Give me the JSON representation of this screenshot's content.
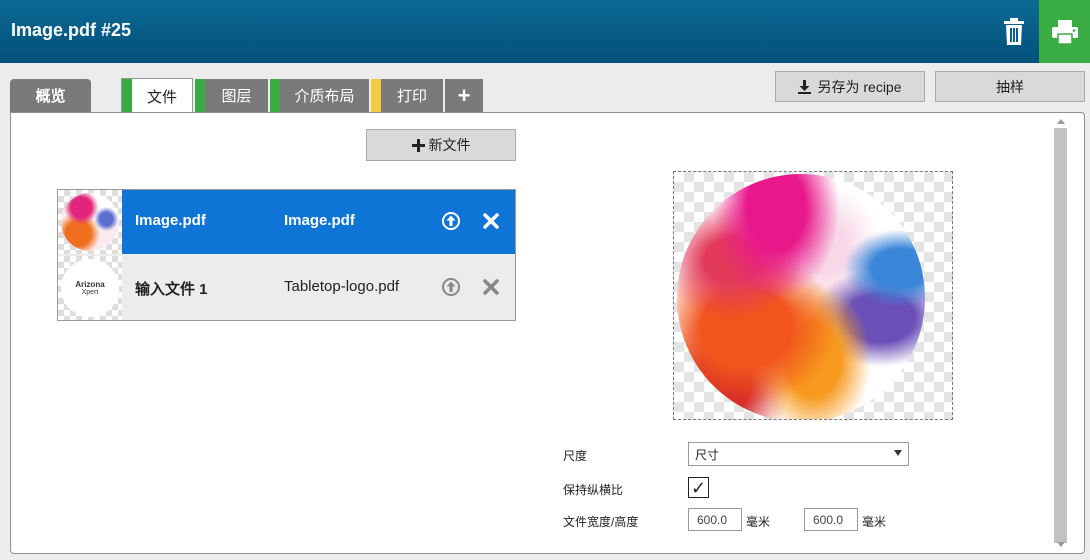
{
  "header": {
    "title": "Image.pdf #25",
    "icons": {
      "delete": "trash-icon",
      "print": "printer-icon"
    },
    "colors": {
      "bar": "#03507a",
      "print_button": "#3aac44"
    }
  },
  "tabs": [
    {
      "label": "概览",
      "marker_color": ""
    },
    {
      "label": "文件",
      "marker_color": "#3aac44"
    },
    {
      "label": "图层",
      "marker_color": "#3aac44"
    },
    {
      "label": "介质布局",
      "marker_color": "#3aac44"
    },
    {
      "label": "打印",
      "marker_color": "#f5c842"
    },
    {
      "label": "+",
      "marker_color": ""
    }
  ],
  "toolbar": {
    "save_recipe_label": "另存为 recipe",
    "sample_label": "抽样",
    "new_file_label": "新文件"
  },
  "files": [
    {
      "name": "Image.pdf",
      "source": "Image.pdf",
      "selected": true
    },
    {
      "name": "输入文件 1",
      "source": "Tabletop-logo.pdf",
      "selected": false,
      "thumb_text_1": "Arizona",
      "thumb_text_2": "Xpert"
    }
  ],
  "form": {
    "scale_label": "尺度",
    "scale_value": "尺寸",
    "aspect_label": "保持纵横比",
    "aspect_checked": true,
    "size_label": "文件宽度/高度",
    "width_value": "600.0",
    "height_value": "600.0",
    "unit": "毫米"
  },
  "colors": {
    "selected_row": "#0e75d6"
  }
}
